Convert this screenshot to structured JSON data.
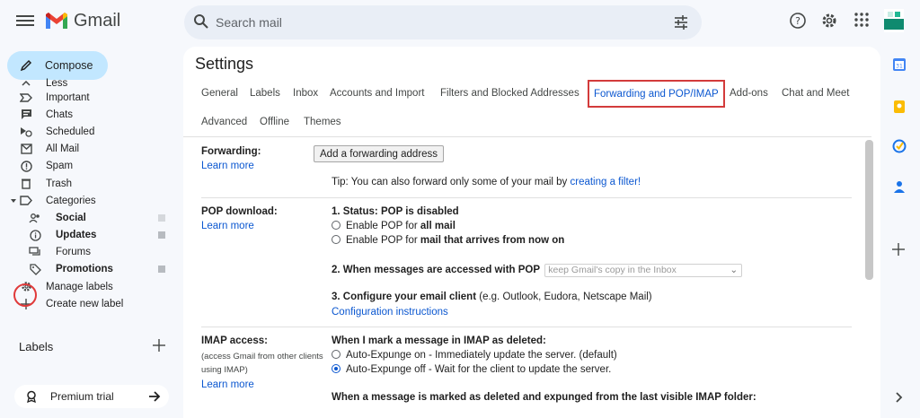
{
  "app": {
    "name": "Gmail"
  },
  "search": {
    "placeholder": "Search mail"
  },
  "compose": {
    "label": "Compose"
  },
  "sidebar": {
    "items": [
      {
        "label": "Less",
        "icon": "chevron-up-icon"
      },
      {
        "label": "Important",
        "icon": "important-icon"
      },
      {
        "label": "Chats",
        "icon": "chat-icon"
      },
      {
        "label": "Scheduled",
        "icon": "scheduled-icon"
      },
      {
        "label": "All Mail",
        "icon": "all-mail-icon"
      },
      {
        "label": "Spam",
        "icon": "spam-icon"
      },
      {
        "label": "Trash",
        "icon": "trash-icon"
      },
      {
        "label": "Categories",
        "icon": "label-icon"
      },
      {
        "label": "Social",
        "icon": "people-icon"
      },
      {
        "label": "Updates",
        "icon": "info-icon"
      },
      {
        "label": "Forums",
        "icon": "forum-icon"
      },
      {
        "label": "Promotions",
        "icon": "tag-icon"
      },
      {
        "label": "Manage labels",
        "icon": "gear-icon"
      },
      {
        "label": "Create new label",
        "icon": "plus-icon"
      }
    ],
    "labels_heading": "Labels",
    "premium": "Premium trial"
  },
  "settings": {
    "title": "Settings",
    "tabs": [
      "General",
      "Labels",
      "Inbox",
      "Accounts and Import",
      "Filters and Blocked Addresses",
      "Forwarding and POP/IMAP",
      "Add-ons",
      "Chat and Meet",
      "Advanced",
      "Offline",
      "Themes"
    ],
    "active_tab": "Forwarding and POP/IMAP",
    "learn_more": "Learn more",
    "forwarding": {
      "label": "Forwarding:",
      "button": "Add a forwarding address",
      "tip": "Tip: You can also forward only some of your mail by ",
      "tip_link": "creating a filter!"
    },
    "pop": {
      "label": "POP download:",
      "status_prefix": "1. Status: ",
      "status": "POP is disabled",
      "opt1_prefix": "Enable POP for ",
      "opt1_bold": "all mail",
      "opt2_prefix": "Enable POP for ",
      "opt2_bold": "mail that arrives from now on",
      "q2": "2. When messages are accessed with POP",
      "q2_select": "keep Gmail's copy in the Inbox",
      "q3": "3. Configure your email client",
      "q3_suffix": " (e.g. Outlook, Eudora, Netscape Mail)",
      "config_link": "Configuration instructions"
    },
    "imap": {
      "label": "IMAP access:",
      "sub": "(access Gmail from other clients using IMAP)",
      "q1": "When I mark a message in IMAP as deleted:",
      "opt1": "Auto-Expunge on - Immediately update the server. (default)",
      "opt2": "Auto-Expunge off - Wait for the client to update the server.",
      "q2": "When a message is marked as deleted and expunged from the last visible IMAP folder:"
    }
  },
  "colors": {
    "accent": "#0b57d0",
    "compose_bg": "#c2e7ff",
    "highlight": "#d33b3b"
  }
}
